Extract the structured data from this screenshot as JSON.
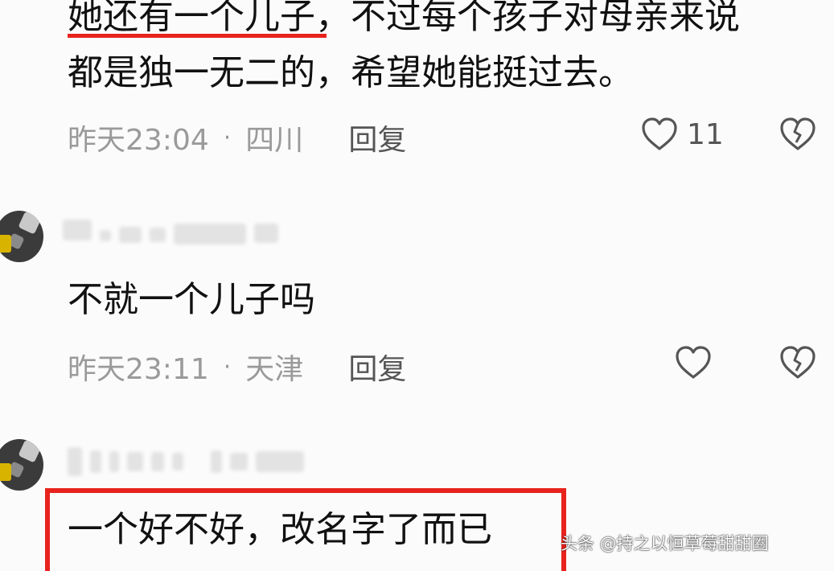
{
  "comments": [
    {
      "text_line1": "她还有一个儿子，不过每个孩子对母亲来说",
      "text_line2": "都是独一无二的，希望她能挺过去。",
      "time": "昨天23:04",
      "separator": "·",
      "location": "四川",
      "reply_label": "回复",
      "like_count": "11",
      "highlight": "underline"
    },
    {
      "text": "不就一个儿子吗",
      "time": "昨天23:11",
      "separator": "·",
      "location": "天津",
      "reply_label": "回复",
      "like_count": ""
    },
    {
      "text": "一个好不好，改名字了而已",
      "highlight": "red-box"
    }
  ],
  "watermark": "头条 @持之以恒草莓甜甜圈",
  "colors": {
    "highlight": "#e8231e",
    "meta": "#9a9a9a",
    "text": "#111111"
  },
  "icons": [
    "heart-icon",
    "broken-heart-icon",
    "avatar"
  ]
}
